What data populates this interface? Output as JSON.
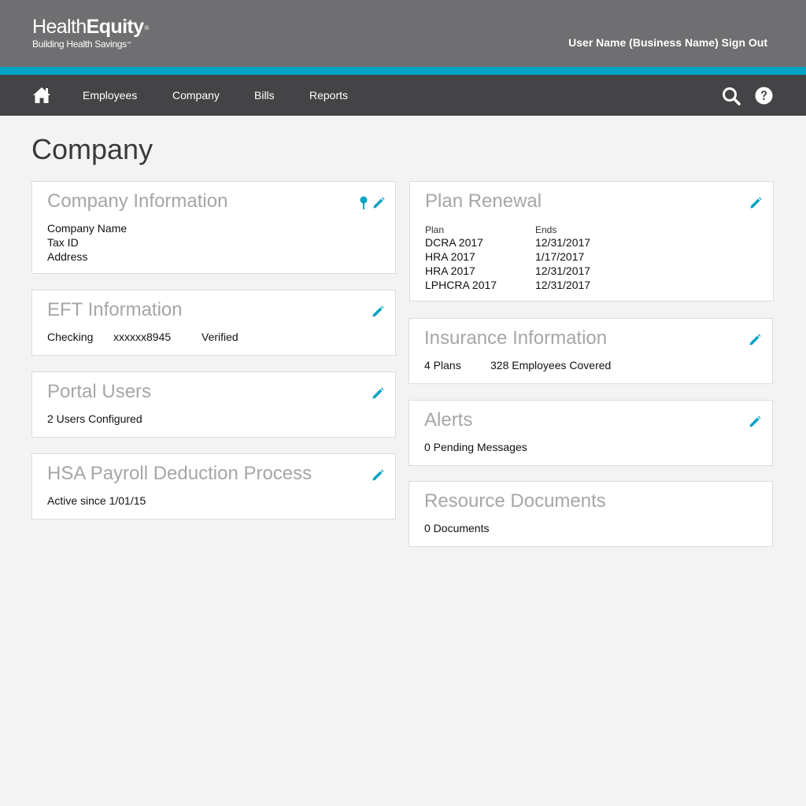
{
  "brand": {
    "name_light": "Health",
    "name_bold": "Equity",
    "trademark": "®",
    "tagline": "Building Health Savings",
    "tagline_mark": "™"
  },
  "header": {
    "user_line": "User Name (Business Name) Sign Out"
  },
  "nav": {
    "home_icon": "home-icon",
    "items": [
      "Employees",
      "Company",
      "Bills",
      "Reports"
    ],
    "search_icon": "search-icon",
    "help_icon": "help-icon"
  },
  "colors": {
    "accent": "#00a3c4",
    "topbar": "#6f6f71",
    "navbar": "#444446",
    "background": "#f3f3f3"
  },
  "page": {
    "title": "Company"
  },
  "company_info": {
    "title": "Company Information",
    "lines": [
      "Company Name",
      "Tax ID",
      "Address"
    ]
  },
  "eft": {
    "title": "EFT Information",
    "account_type": "Checking",
    "account_number": "xxxxxx8945",
    "status": "Verified"
  },
  "portal_users": {
    "title": "Portal Users",
    "text": "2 Users Configured"
  },
  "hsa_payroll": {
    "title": "HSA Payroll Deduction Process",
    "text": "Active since 1/01/15"
  },
  "plan_renewal": {
    "title": "Plan Renewal",
    "columns": [
      "Plan",
      "Ends"
    ],
    "rows": [
      {
        "plan": "DCRA 2017",
        "ends": "12/31/2017"
      },
      {
        "plan": "HRA 2017",
        "ends": "1/17/2017"
      },
      {
        "plan": "HRA 2017",
        "ends": "12/31/2017"
      },
      {
        "plan": "LPHCRA 2017",
        "ends": "12/31/2017"
      }
    ]
  },
  "insurance": {
    "title": "Insurance Information",
    "plans": "4 Plans",
    "employees": "328 Employees Covered"
  },
  "alerts": {
    "title": "Alerts",
    "text": "0 Pending Messages"
  },
  "resources": {
    "title": "Resource Documents",
    "text": "0 Documents"
  }
}
